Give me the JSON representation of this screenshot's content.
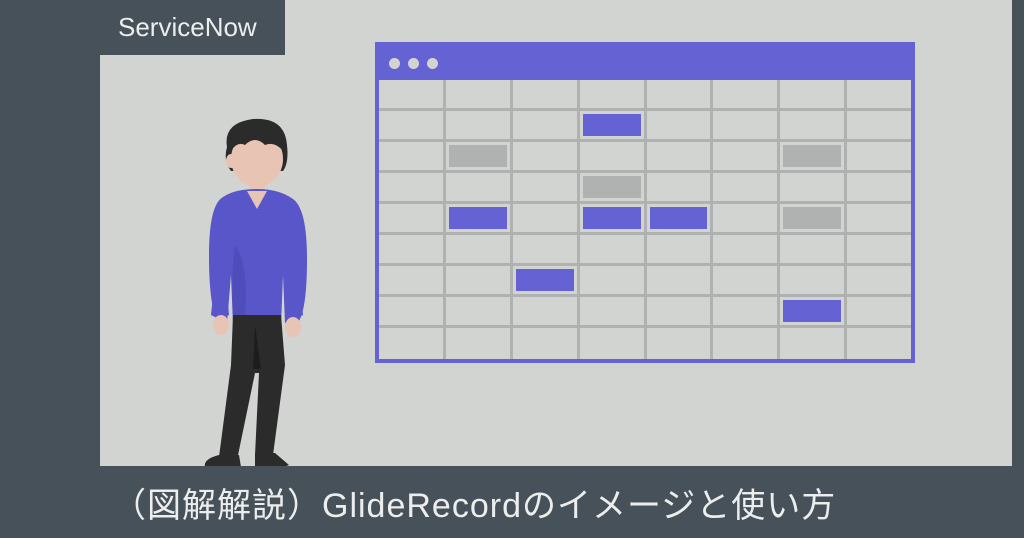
{
  "tag": {
    "label": "ServiceNow"
  },
  "title": "（図解解説）GlideRecordのイメージと使い方",
  "colors": {
    "accent": "#6562d4",
    "dark": "#475159",
    "background": "#d2d4d2",
    "grid_line": "#b0b2b1"
  },
  "grid": {
    "cols": 8,
    "rows": 9,
    "fills": [
      {
        "r": 1,
        "c": 3,
        "color": "purple"
      },
      {
        "r": 2,
        "c": 1,
        "color": "gray"
      },
      {
        "r": 2,
        "c": 6,
        "color": "gray"
      },
      {
        "r": 3,
        "c": 3,
        "color": "gray"
      },
      {
        "r": 4,
        "c": 1,
        "color": "purple"
      },
      {
        "r": 4,
        "c": 3,
        "color": "purple"
      },
      {
        "r": 4,
        "c": 4,
        "color": "purple"
      },
      {
        "r": 4,
        "c": 6,
        "color": "gray"
      },
      {
        "r": 6,
        "c": 2,
        "color": "purple"
      },
      {
        "r": 7,
        "c": 6,
        "color": "purple"
      }
    ]
  }
}
